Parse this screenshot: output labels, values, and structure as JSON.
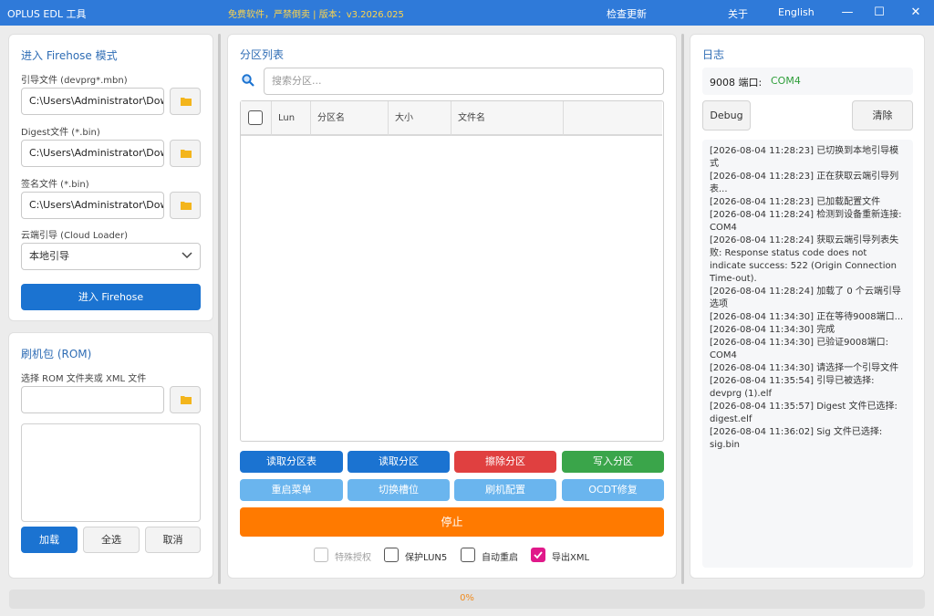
{
  "titlebar": {
    "app_title": "OPLUS EDL 工具",
    "center_note": "免费软件，严禁倒卖 | 版本：v3.2026.025",
    "check_update": "检查更新",
    "about": "关于",
    "language": "English",
    "minimize": "—",
    "maximize": "☐",
    "close": "✕"
  },
  "firehose": {
    "title": "进入 Firehose 模式",
    "loader_label": "引导文件 (devprg*.mbn)",
    "loader_value": "C:\\Users\\Administrator\\Dow",
    "digest_label": "Digest文件 (*.bin)",
    "digest_value": "C:\\Users\\Administrator\\Dow",
    "sig_label": "签名文件 (*.bin)",
    "sig_value": "C:\\Users\\Administrator\\Dow",
    "cloud_label": "云端引导 (Cloud Loader)",
    "cloud_value": "本地引导",
    "enter_button": "进入 Firehose"
  },
  "rom": {
    "title": "刷机包 (ROM)",
    "select_label": "选择 ROM 文件夹或 XML 文件",
    "path_value": "",
    "load_button": "加载",
    "select_all_button": "全选",
    "cancel_button": "取消"
  },
  "partitions": {
    "title": "分区列表",
    "search_placeholder": "搜索分区...",
    "columns": [
      "Lun",
      "分区名",
      "大小",
      "文件名"
    ],
    "rows": [],
    "buttons_row1": [
      "读取分区表",
      "读取分区",
      "擦除分区",
      "写入分区"
    ],
    "buttons_row2": [
      "重启菜单",
      "切换槽位",
      "刷机配置",
      "OCDT修复"
    ],
    "stop_button": "停止",
    "options": [
      {
        "label": "特殊授权",
        "checked": false,
        "disabled": true
      },
      {
        "label": "保护LUN5",
        "checked": false,
        "disabled": false
      },
      {
        "label": "自动重启",
        "checked": false,
        "disabled": false
      },
      {
        "label": "导出XML",
        "checked": true,
        "disabled": false
      }
    ]
  },
  "log": {
    "title": "日志",
    "port_label": "9008 端口:",
    "port_value": "COM4",
    "debug_button": "Debug",
    "clear_button": "清除",
    "lines": [
      "[2026-08-04 11:28:23] 已切换到本地引导模式",
      "[2026-08-04 11:28:23] 正在获取云端引导列表...",
      "[2026-08-04 11:28:23] 已加载配置文件",
      "[2026-08-04 11:28:24] 检测到设备重新连接: COM4",
      "[2026-08-04 11:28:24] 获取云端引导列表失败: Response status code does not indicate success: 522 (Origin Connection Time-out).",
      "[2026-08-04 11:28:24] 加载了 0 个云端引导选项",
      "[2026-08-04 11:34:30] 正在等待9008端口...",
      "[2026-08-04 11:34:30] 完成",
      "[2026-08-04 11:34:30] 已验证9008端口: COM4",
      "[2026-08-04 11:34:30] 请选择一个引导文件",
      "[2026-08-04 11:35:54] 引导已被选择: devprg (1).elf",
      "[2026-08-04 11:35:57] Digest 文件已选择: digest.elf",
      "[2026-08-04 11:36:02] Sig 文件已选择: sig.bin"
    ]
  },
  "progress": {
    "text": "0%",
    "value": 0
  },
  "colors": {
    "titlebar": "#2f7ad9",
    "accent": "#1b73d1",
    "danger": "#e04040",
    "success": "#3aa54a",
    "secondary": "#6ab5ee",
    "stop": "#ff7a00",
    "port_ok": "#2e9e3a"
  }
}
